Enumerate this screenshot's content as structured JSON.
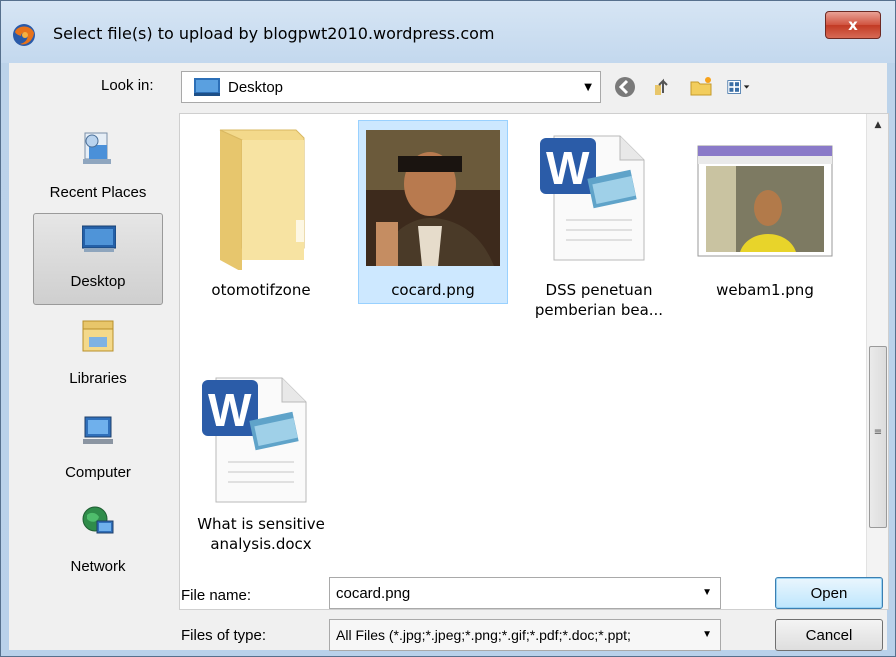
{
  "window": {
    "title": "Select file(s) to upload by blogpwt2010.wordpress.com",
    "close_label": "x"
  },
  "look_in": {
    "label": "Look in:",
    "value": "Desktop"
  },
  "places": [
    {
      "label": "Recent Places",
      "icon": "recent-places-icon",
      "selected": false
    },
    {
      "label": "Desktop",
      "icon": "desktop-icon",
      "selected": true
    },
    {
      "label": "Libraries",
      "icon": "libraries-icon",
      "selected": false
    },
    {
      "label": "Computer",
      "icon": "computer-icon",
      "selected": false
    },
    {
      "label": "Network",
      "icon": "network-icon",
      "selected": false
    }
  ],
  "files": [
    {
      "name": "otomotifzone",
      "type": "folder",
      "selected": false
    },
    {
      "name": "cocard.png",
      "type": "image",
      "selected": true
    },
    {
      "name": "DSS penetuan pemberian bea...",
      "type": "word",
      "selected": false
    },
    {
      "name": "webam1.png",
      "type": "image",
      "selected": false
    },
    {
      "name": "What is sensitive analysis.docx",
      "type": "word",
      "selected": false
    }
  ],
  "file_name": {
    "label": "File name:",
    "value": "cocard.png"
  },
  "files_of_type": {
    "label": "Files of type:",
    "value": "All Files (*.jpg;*.jpeg;*.png;*.gif;*.pdf;*.doc;*.ppt;"
  },
  "buttons": {
    "open": "Open",
    "cancel": "Cancel"
  },
  "colors": {
    "title_bar": "#c3d8ee",
    "close_button": "#c23a24",
    "selection": "#cde8ff",
    "primary_button": "#bee6fd"
  }
}
